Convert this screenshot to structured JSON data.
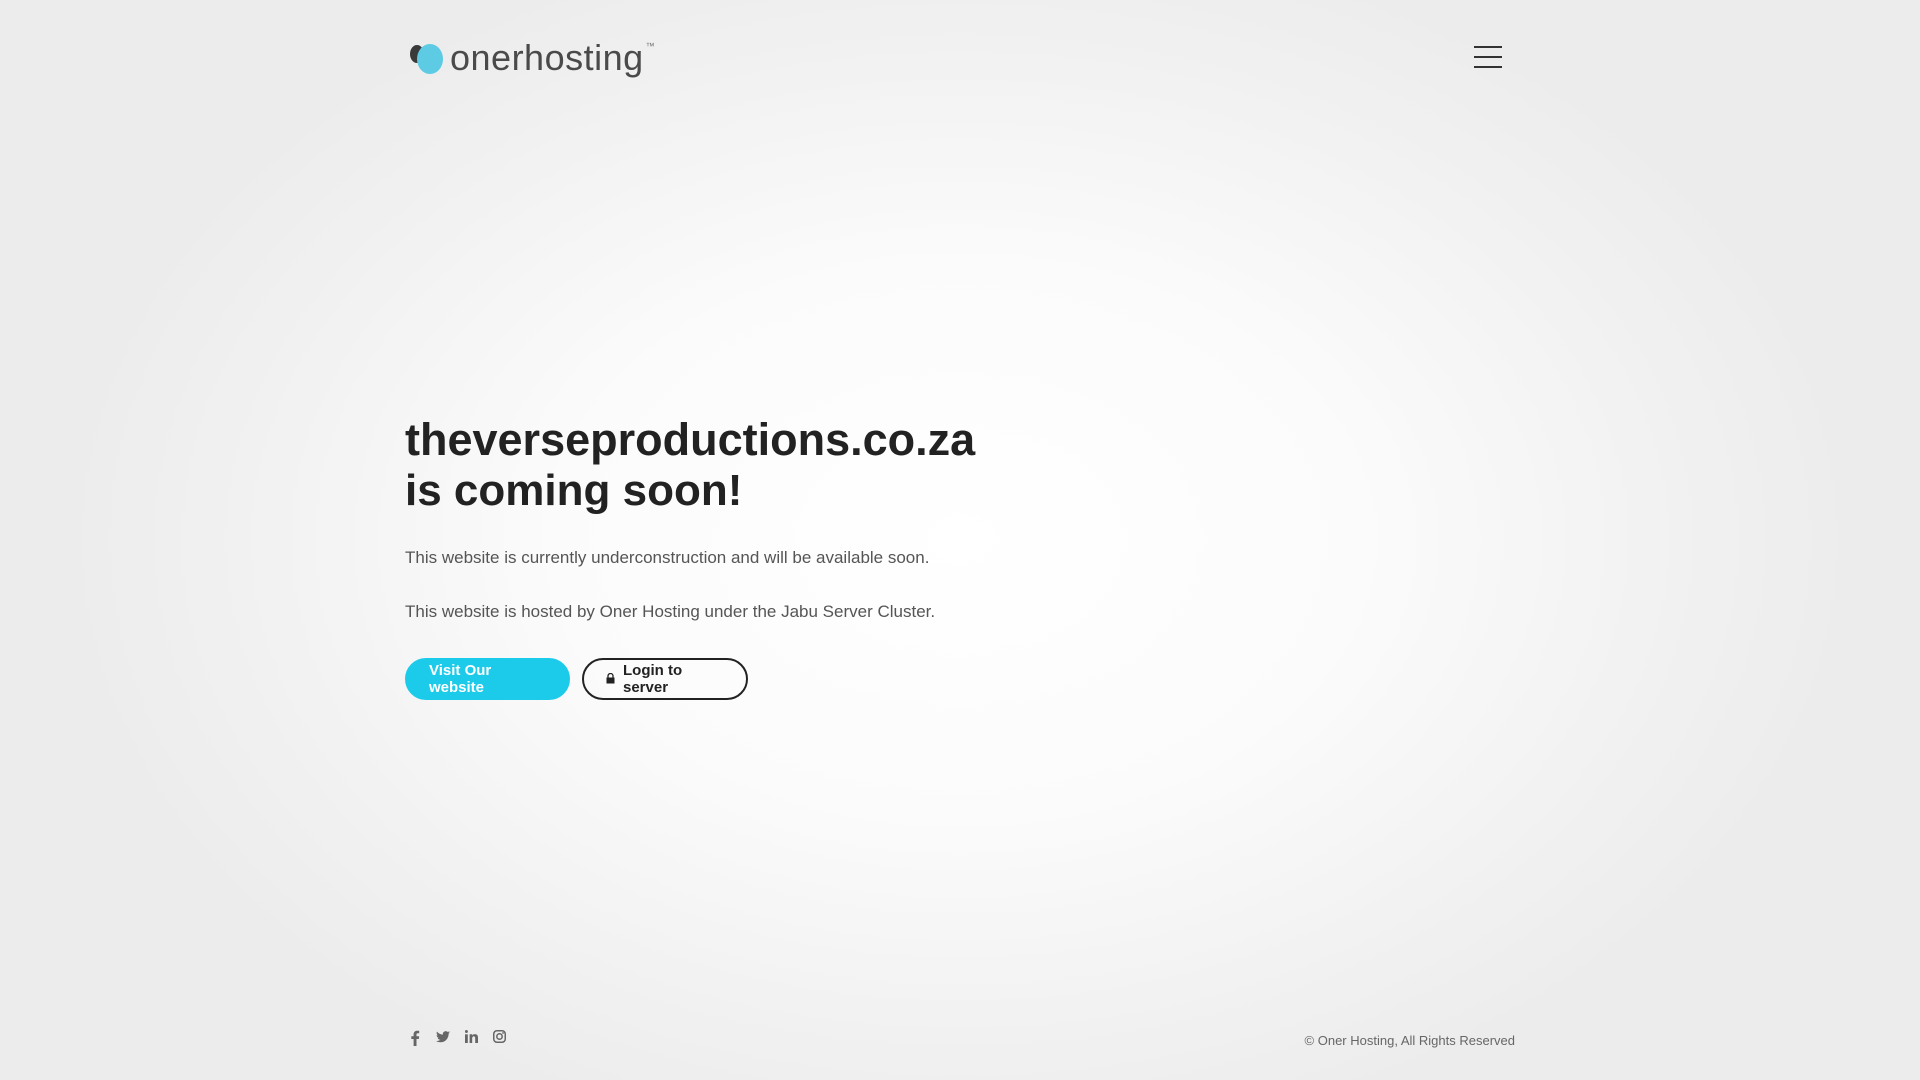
{
  "header": {
    "logo_text": "onerhosting",
    "logo_tm": "™",
    "logo_colors": {
      "drop_dark": "#3a3a3a",
      "drop_blue": "#5ccbe3",
      "text": "#4a4a4a"
    },
    "menu_icon": "hamburger-menu-icon"
  },
  "main": {
    "domain": "theverseproductions.co.za",
    "subtitle": "is coming soon!",
    "paragraph1": "This website is currently underconstruction and will be available soon.",
    "paragraph2": "This website is hosted by Oner Hosting under the Jabu Server Cluster.",
    "primary_button": "Visit Our website",
    "secondary_button": "Login to server",
    "secondary_button_icon": "lock-icon",
    "accent_color": "#1ccbe9"
  },
  "footer": {
    "social_icons": [
      "facebook-icon",
      "twitter-icon",
      "linkedin-icon",
      "instagram-icon"
    ],
    "copyright": "© Oner Hosting, All Rights Reserved"
  }
}
